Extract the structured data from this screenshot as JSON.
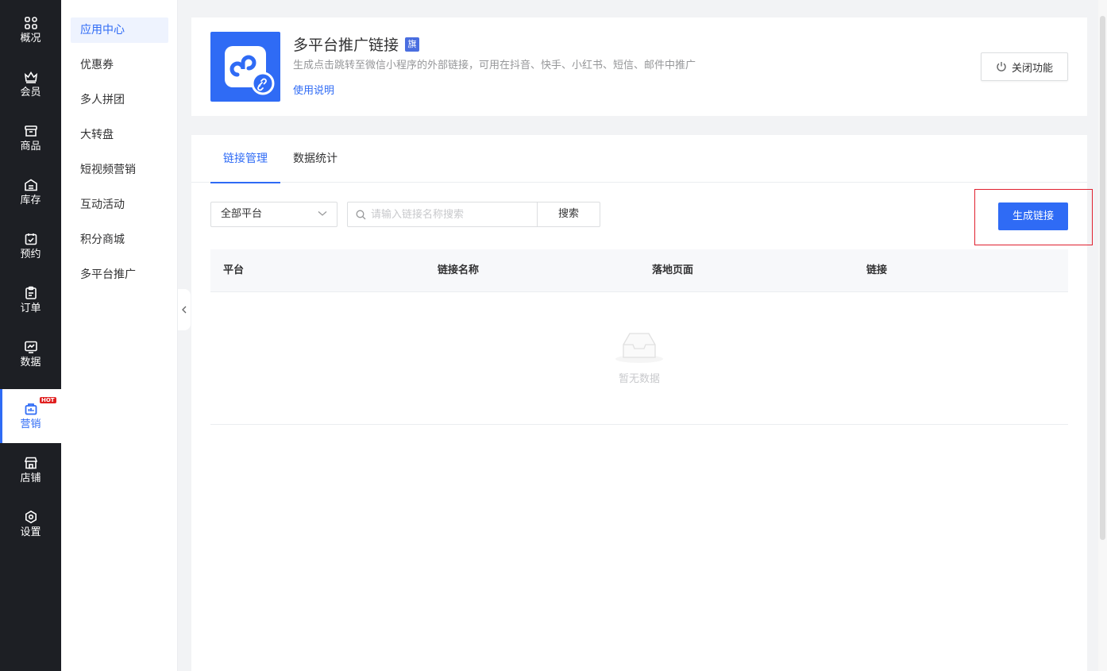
{
  "nav": {
    "items": [
      {
        "label": "概况",
        "icon": "grid-icon"
      },
      {
        "label": "会员",
        "icon": "crown-icon"
      },
      {
        "label": "商品",
        "icon": "shop-box-icon"
      },
      {
        "label": "库存",
        "icon": "warehouse-icon"
      },
      {
        "label": "预约",
        "icon": "calendar-check-icon"
      },
      {
        "label": "订单",
        "icon": "clipboard-icon"
      },
      {
        "label": "数据",
        "icon": "chart-icon"
      },
      {
        "label": "营销",
        "icon": "marketing-icon",
        "badge": "HOT"
      },
      {
        "label": "店铺",
        "icon": "store-icon"
      },
      {
        "label": "设置",
        "icon": "settings-icon"
      }
    ]
  },
  "subnav": {
    "items": [
      "应用中心",
      "优惠券",
      "多人拼团",
      "大转盘",
      "短视频营销",
      "互动活动",
      "积分商城",
      "多平台推广"
    ]
  },
  "app": {
    "title": "多平台推广链接",
    "flag": "旗",
    "description": "生成点击跳转至微信小程序的外部链接，可用在抖音、快手、小红书、短信、邮件中推广",
    "help_link": "使用说明",
    "close_button": "关闭功能"
  },
  "tabs": [
    "链接管理",
    "数据统计"
  ],
  "filter": {
    "platform_value": "全部平台",
    "search_placeholder": "请输入链接名称搜索",
    "search_button": "搜索",
    "generate_button": "生成链接"
  },
  "table": {
    "columns": [
      "平台",
      "链接名称",
      "落地页面",
      "链接"
    ],
    "empty_text": "暂无数据"
  },
  "colors": {
    "accent": "#2f6bf5",
    "nav_bg": "#1d1f24",
    "highlight": "#e0202f"
  }
}
